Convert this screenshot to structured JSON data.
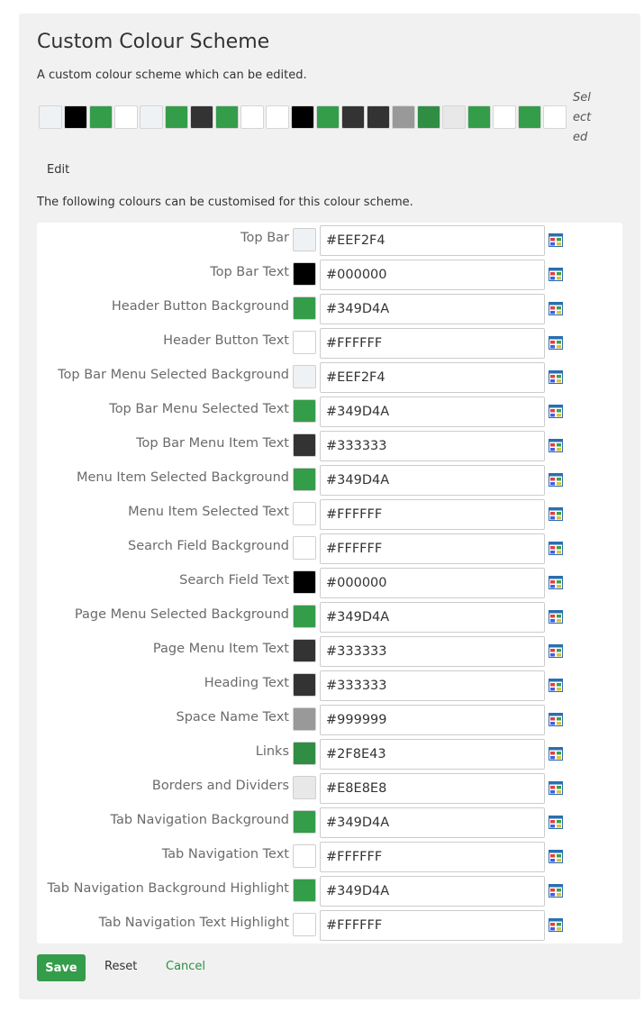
{
  "page": {
    "title": "Custom Colour Scheme",
    "description": "A custom colour scheme which can be edited.",
    "selected_label": "Selected",
    "edit_label": "Edit",
    "customise_note": "The following colours can be customised for this colour scheme."
  },
  "preview_swatches": [
    "#EEF2F4",
    "#000000",
    "#349D4A",
    "#FFFFFF",
    "#EEF2F4",
    "#349D4A",
    "#333333",
    "#349D4A",
    "#FFFFFF",
    "#FFFFFF",
    "#000000",
    "#349D4A",
    "#333333",
    "#333333",
    "#999999",
    "#2F8E43",
    "#E8E8E8",
    "#349D4A",
    "#FFFFFF",
    "#349D4A",
    "#FFFFFF"
  ],
  "colours": [
    {
      "label": "Top Bar",
      "value": "#EEF2F4"
    },
    {
      "label": "Top Bar Text",
      "value": "#000000"
    },
    {
      "label": "Header Button Background",
      "value": "#349D4A"
    },
    {
      "label": "Header Button Text",
      "value": "#FFFFFF"
    },
    {
      "label": "Top Bar Menu Selected Background",
      "value": "#EEF2F4"
    },
    {
      "label": "Top Bar Menu Selected Text",
      "value": "#349D4A"
    },
    {
      "label": "Top Bar Menu Item Text",
      "value": "#333333"
    },
    {
      "label": "Menu Item Selected Background",
      "value": "#349D4A"
    },
    {
      "label": "Menu Item Selected Text",
      "value": "#FFFFFF"
    },
    {
      "label": "Search Field Background",
      "value": "#FFFFFF"
    },
    {
      "label": "Search Field Text",
      "value": "#000000"
    },
    {
      "label": "Page Menu Selected Background",
      "value": "#349D4A"
    },
    {
      "label": "Page Menu Item Text",
      "value": "#333333"
    },
    {
      "label": "Heading Text",
      "value": "#333333"
    },
    {
      "label": "Space Name Text",
      "value": "#999999"
    },
    {
      "label": "Links",
      "value": "#2F8E43"
    },
    {
      "label": "Borders and Dividers",
      "value": "#E8E8E8"
    },
    {
      "label": "Tab Navigation Background",
      "value": "#349D4A"
    },
    {
      "label": "Tab Navigation Text",
      "value": "#FFFFFF"
    },
    {
      "label": "Tab Navigation Background Highlight",
      "value": "#349D4A"
    },
    {
      "label": "Tab Navigation Text Highlight",
      "value": "#FFFFFF"
    }
  ],
  "picker_icon": "colour-picker-icon",
  "actions": {
    "save": "Save",
    "reset": "Reset",
    "cancel": "Cancel"
  },
  "theme": {
    "accent": "#349D4A",
    "link": "#2F8E43"
  }
}
